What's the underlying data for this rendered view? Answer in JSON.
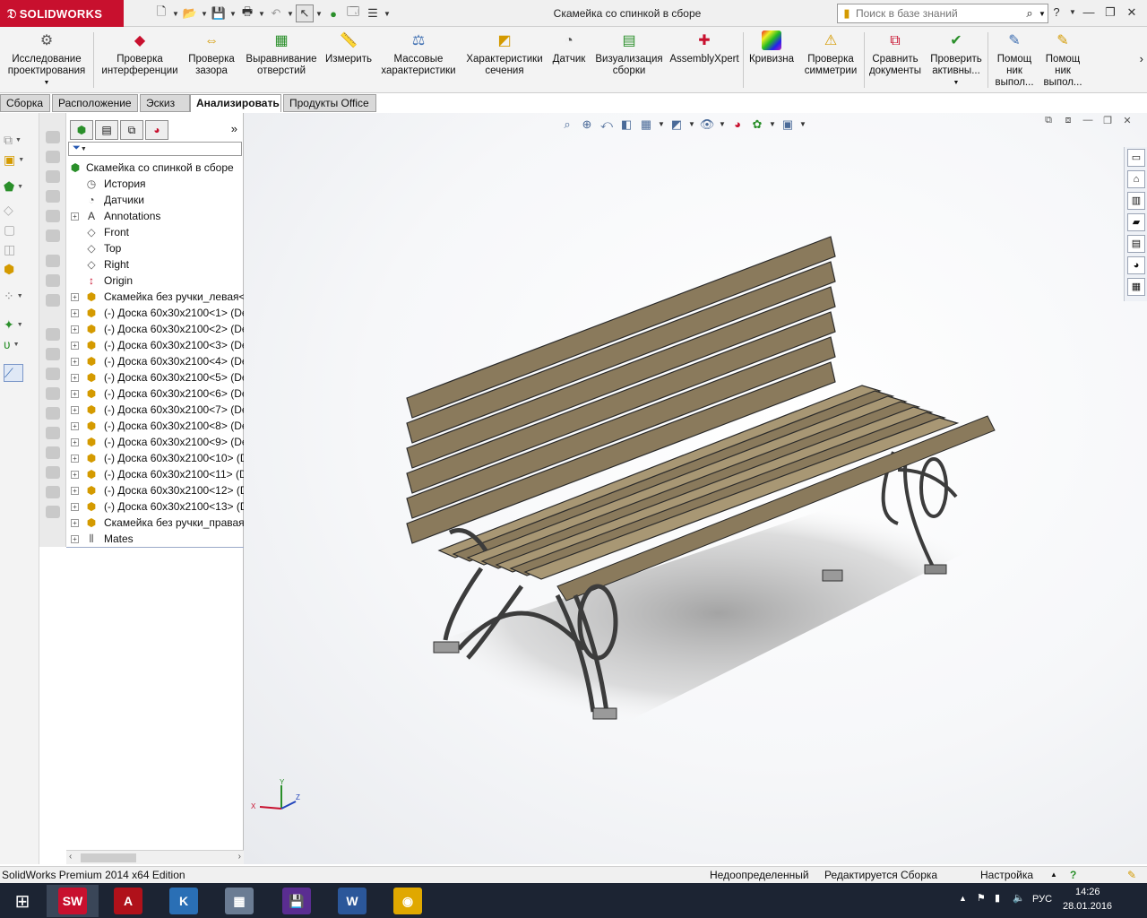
{
  "app": {
    "logo_text": "SOLIDWORKS",
    "document_title": "Скамейка со спинкой в сборе",
    "search_placeholder": "Поиск в базе знаний"
  },
  "ribbon": {
    "buttons": [
      {
        "label": "Исследование проектирования",
        "icon": "design-study-icon"
      },
      {
        "label": "Проверка интерференции",
        "icon": "interference-icon"
      },
      {
        "label": "Проверка зазора",
        "icon": "clearance-icon"
      },
      {
        "label": "Выравнивание отверстий",
        "icon": "hole-alignment-icon"
      },
      {
        "label": "Измерить",
        "icon": "measure-icon"
      },
      {
        "label": "Массовые характеристики",
        "icon": "mass-properties-icon"
      },
      {
        "label": "Характеристики сечения",
        "icon": "section-properties-icon"
      },
      {
        "label": "Датчик",
        "icon": "sensor-icon"
      },
      {
        "label": "Визуализация сборки",
        "icon": "assembly-visualization-icon"
      },
      {
        "label": "AssemblyXpert",
        "icon": "assemblyxpert-icon"
      },
      {
        "label": "Кривизна",
        "icon": "curvature-icon"
      },
      {
        "label": "Проверка симметрии",
        "icon": "symmetry-check-icon"
      },
      {
        "label": "Сравнить документы",
        "icon": "compare-documents-icon"
      },
      {
        "label": "Проверить активны...",
        "icon": "check-active-icon"
      },
      {
        "label": "Помощ ник выпол...",
        "icon": "assistant-icon"
      },
      {
        "label": "Помощ ник выпол...",
        "icon": "assistant-2-icon"
      }
    ]
  },
  "tabs": [
    {
      "label": "Сборка"
    },
    {
      "label": "Расположение"
    },
    {
      "label": "Эскиз"
    },
    {
      "label": "Анализировать",
      "active": true
    },
    {
      "label": "Продукты Office"
    }
  ],
  "tree": {
    "root": "Скамейка со спинкой в сборе",
    "items": [
      {
        "label": "История",
        "icon": "history-icon",
        "exp": false
      },
      {
        "label": "Датчики",
        "icon": "sensors-icon",
        "exp": false
      },
      {
        "label": "Annotations",
        "icon": "annotations-icon",
        "exp": true
      },
      {
        "label": "Front",
        "icon": "plane-icon",
        "exp": false
      },
      {
        "label": "Top",
        "icon": "plane-icon",
        "exp": false
      },
      {
        "label": "Right",
        "icon": "plane-icon",
        "exp": false
      },
      {
        "label": "Origin",
        "icon": "origin-icon",
        "exp": false
      },
      {
        "label": "Скамейка без  ручки_левая<",
        "icon": "subassembly-icon",
        "exp": true
      },
      {
        "label": "(-) Доска 60х30х2100<1> (De",
        "icon": "part-icon",
        "exp": true
      },
      {
        "label": "(-) Доска 60х30х2100<2> (De",
        "icon": "part-icon",
        "exp": true
      },
      {
        "label": "(-) Доска 60х30х2100<3> (De",
        "icon": "part-icon",
        "exp": true
      },
      {
        "label": "(-) Доска 60х30х2100<4> (De",
        "icon": "part-icon",
        "exp": true
      },
      {
        "label": "(-) Доска 60х30х2100<5> (De",
        "icon": "part-icon",
        "exp": true
      },
      {
        "label": "(-) Доска 60х30х2100<6> (De",
        "icon": "part-icon",
        "exp": true
      },
      {
        "label": "(-) Доска 60х30х2100<7> (De",
        "icon": "part-icon",
        "exp": true
      },
      {
        "label": "(-) Доска 60х30х2100<8> (De",
        "icon": "part-icon",
        "exp": true
      },
      {
        "label": "(-) Доска 60х30х2100<9> (De",
        "icon": "part-icon",
        "exp": true
      },
      {
        "label": "(-) Доска 60х30х2100<10> (D",
        "icon": "part-icon",
        "exp": true
      },
      {
        "label": "(-) Доска 60х30х2100<11> (D",
        "icon": "part-icon",
        "exp": true
      },
      {
        "label": "(-) Доска 60х30х2100<12> (D",
        "icon": "part-icon",
        "exp": true
      },
      {
        "label": "(-) Доска 60х30х2100<13> (D",
        "icon": "part-icon",
        "exp": true
      },
      {
        "label": "Скамейка без  ручки_правая",
        "icon": "subassembly-icon",
        "exp": true
      },
      {
        "label": "Mates",
        "icon": "mates-icon",
        "exp": true
      }
    ]
  },
  "triad": {
    "x": "X",
    "y": "Y",
    "z": "Z"
  },
  "status": {
    "edition": "SolidWorks Premium 2014 x64 Edition",
    "definition": "Недоопределенный",
    "editing": "Редактируется Сборка",
    "settings": "Настройка"
  },
  "taskbar": {
    "apps": [
      {
        "name": "solidworks",
        "text": "SW",
        "color": "#c8102e"
      },
      {
        "name": "autocad",
        "text": "A",
        "color": "#b0111a"
      },
      {
        "name": "kompas",
        "text": "K",
        "color": "#2a6fb5"
      },
      {
        "name": "calculator",
        "text": "▦",
        "color": "#6b7c93"
      },
      {
        "name": "save",
        "text": "💾",
        "color": "#5a2d91"
      },
      {
        "name": "word",
        "text": "W",
        "color": "#2b579a"
      },
      {
        "name": "chrome",
        "text": "◉",
        "color": "#e0a800"
      }
    ],
    "lang": "РУС",
    "time": "14:26",
    "date": "28.01.2016"
  },
  "colors": {
    "wood": "#8a7a5c",
    "wood_light": "#a89774",
    "metal": "#6e6e6e",
    "accent": "#c8102e"
  }
}
